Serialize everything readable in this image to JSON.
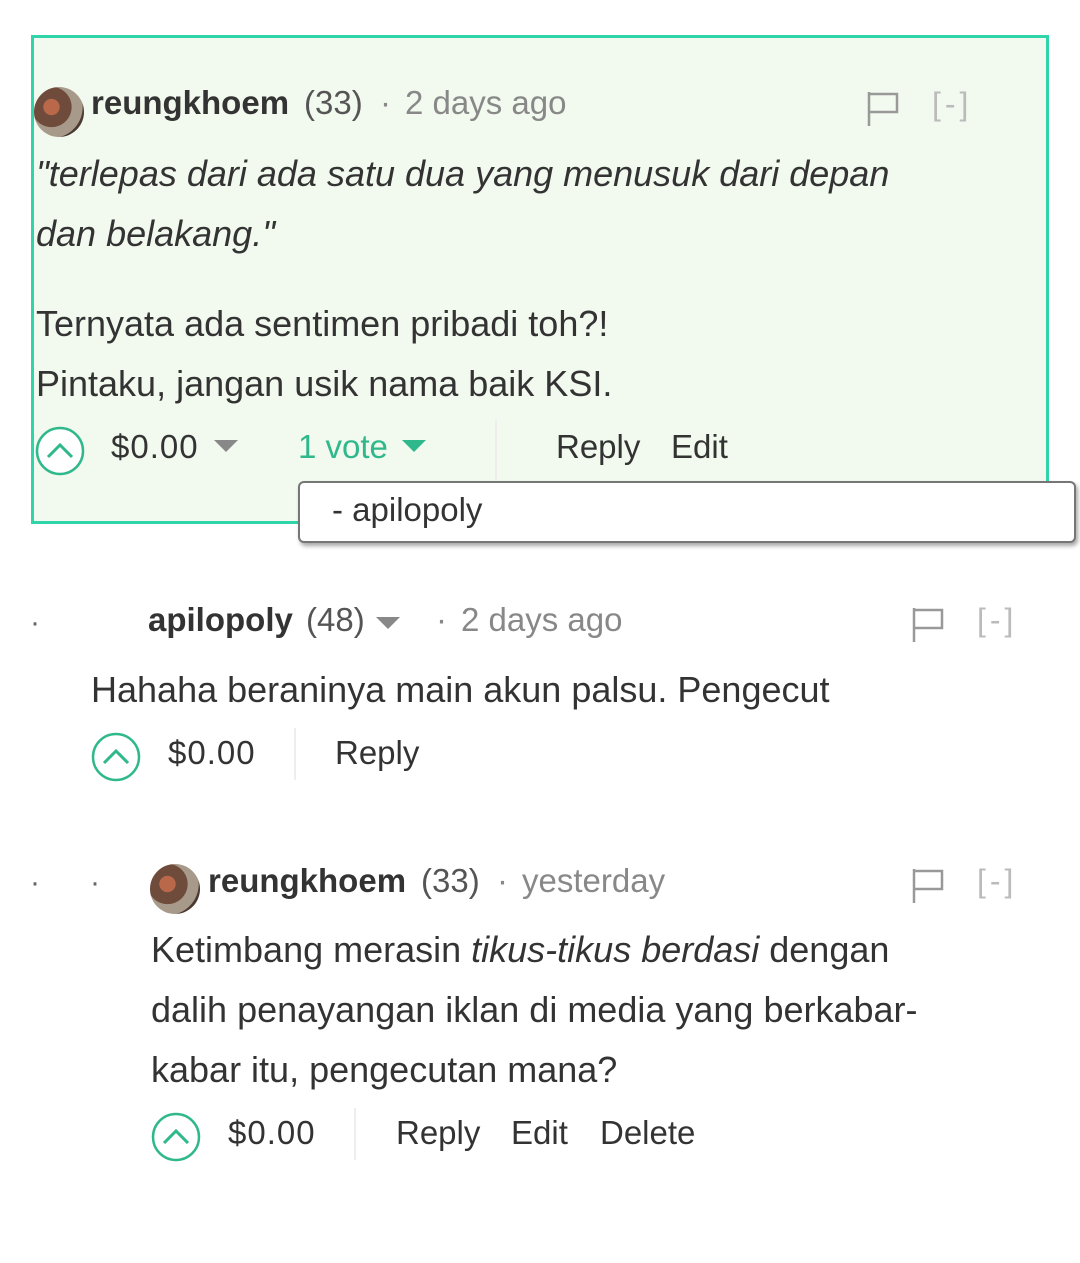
{
  "colors": {
    "accent": "#2fb88b",
    "highlight_border": "#2fd4a8",
    "highlight_bg": "#f2f9ee",
    "muted": "#888888"
  },
  "comments": [
    {
      "author": "reungkhoem",
      "reputation": "(33)",
      "separator": "·",
      "time": "2 days ago",
      "collapse": "[-]",
      "body_lines": [
        "\"terlepas dari ada satu dua yang menusuk dari depan",
        "dan belakang.\""
      ],
      "body_lines_2": [
        "Ternyata ada sentimen pribadi toh?!",
        "Pintaku, jangan usik nama baik KSI."
      ],
      "payout": "$0.00",
      "votes_label": "1 vote",
      "actions": [
        "Reply",
        "Edit"
      ],
      "voters": [
        "- apilopoly"
      ],
      "icons": [
        "avatar",
        "flag-icon",
        "upvote-icon",
        "caret-down-icon"
      ]
    },
    {
      "author": "apilopoly",
      "reputation": "(48)",
      "separator": "·",
      "time": "2 days ago",
      "collapse": "[-]",
      "depth_marker": "·",
      "body": "Hahaha beraninya main akun palsu. Pengecut",
      "payout": "$0.00",
      "actions": [
        "Reply"
      ]
    },
    {
      "author": "reungkhoem",
      "reputation": "(33)",
      "separator": "·",
      "time": "yesterday",
      "collapse": "[-]",
      "depth_markers": [
        "·",
        "·"
      ],
      "body_parts": {
        "line1_a": "Ketimbang merasin ",
        "line1_em": "tikus-tikus berdasi",
        "line1_b": " dengan",
        "line2": "dalih penayangan iklan di media yang berkabar-",
        "line3": "kabar itu, pengecutan mana?"
      },
      "payout": "$0.00",
      "actions": [
        "Reply",
        "Edit",
        "Delete"
      ]
    }
  ]
}
